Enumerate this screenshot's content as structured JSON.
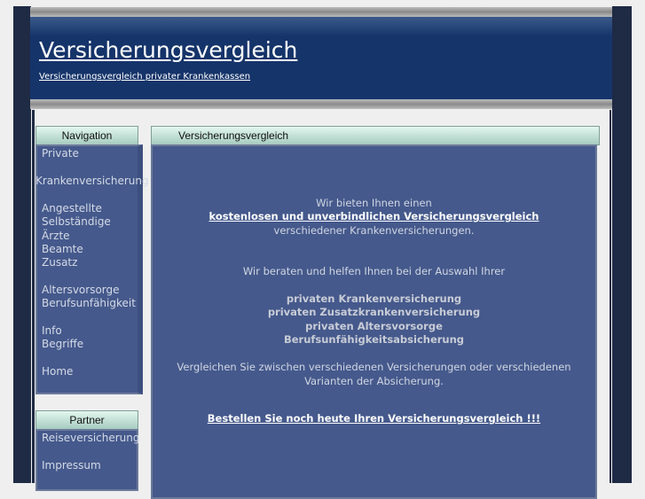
{
  "header": {
    "title": "Versicherungsvergleich",
    "subtitle": "Versicherungsvergleich privater Krankenkassen"
  },
  "navigation": {
    "heading": "Navigation",
    "items": [
      "Private",
      "Krankenversicherung",
      "Angestellte",
      "Selbständige",
      "Ärzte",
      "Beamte",
      "Zusatz",
      "Altersvorsorge",
      "Berufsunfähigkeit",
      "Info",
      "Begriffe",
      "Home"
    ]
  },
  "partner": {
    "heading": "Partner",
    "items": [
      "Reiseversicherung",
      "Impressum"
    ]
  },
  "content": {
    "heading": "Versicherungsvergleich",
    "intro1": "Wir bieten Ihnen einen",
    "intro_link": "kostenlosen und unverbindlichen Versicherungsvergleich",
    "intro2": "verschiedener Krankenversicherungen.",
    "advice": "Wir beraten und helfen Ihnen bei der Auswahl Ihrer",
    "list": [
      "privaten Krankenversicherung",
      "privaten Zusatzkrankenversicherung",
      "privaten Altersvorsorge",
      "Berufsunfähigkeitsabsicherung"
    ],
    "compare1": "Vergleichen Sie zwischen verschiedenen Versicherungen oder verschiedenen",
    "compare2": "Varianten der Absicherung.",
    "cta": "Bestellen Sie noch heute Ihren Versicherungsvergleich !!!"
  }
}
